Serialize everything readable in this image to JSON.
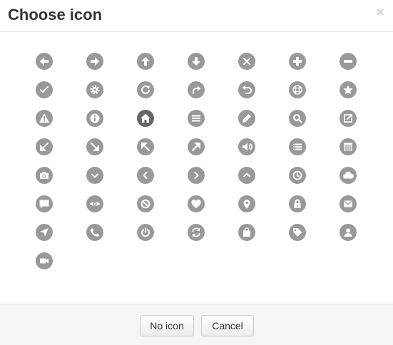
{
  "dialog": {
    "title": "Choose icon",
    "close_label": "×"
  },
  "icons": [
    "arrow-left-icon",
    "arrow-right-icon",
    "arrow-up-icon",
    "arrow-down-icon",
    "remove-icon",
    "plus-icon",
    "minus-icon",
    "check-icon",
    "gear-icon",
    "refresh-icon",
    "share-icon",
    "undo-icon",
    "grid-icon",
    "star-icon",
    "warning-icon",
    "info-icon",
    "home-icon",
    "menu-icon",
    "pencil-icon",
    "search-icon",
    "external-link-icon",
    "arrow-down-left-icon",
    "arrow-down-right-icon",
    "arrow-up-left-icon",
    "arrow-up-right-icon",
    "volume-icon",
    "list-icon",
    "calendar-icon",
    "camera-icon",
    "chevron-down-icon",
    "chevron-left-icon",
    "chevron-right-icon",
    "chevron-up-icon",
    "clock-icon",
    "cloud-icon",
    "comment-icon",
    "eye-icon",
    "ban-icon",
    "heart-icon",
    "map-marker-icon",
    "lock-icon",
    "envelope-icon",
    "navigation-icon",
    "phone-icon",
    "power-icon",
    "sync-icon",
    "shopping-bag-icon",
    "tag-icon",
    "user-icon",
    "video-icon"
  ],
  "selected_icon": "home-icon",
  "footer": {
    "no_icon_label": "No icon",
    "cancel_label": "Cancel"
  },
  "colors": {
    "icon_background": "#999999",
    "icon_selected_background": "#666666",
    "footer_background": "#f5f5f5"
  }
}
